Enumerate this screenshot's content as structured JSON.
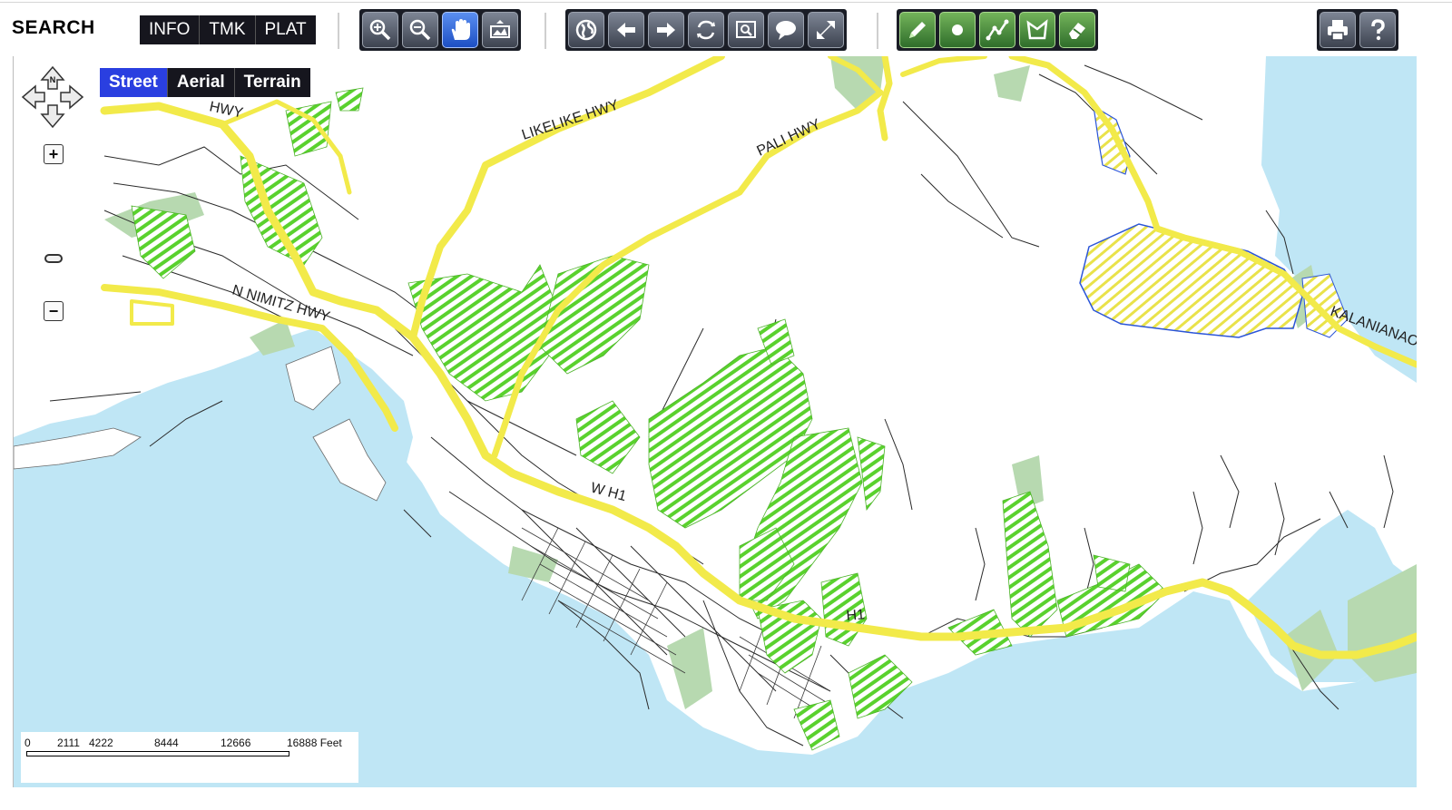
{
  "toolbar": {
    "search_label": "SEARCH",
    "mode_tabs": [
      "INFO",
      "TMK",
      "PLAT"
    ],
    "navigation_tools": [
      {
        "name": "zoom-in-tool",
        "icon": "zoom-in-icon"
      },
      {
        "name": "zoom-out-tool",
        "icon": "zoom-out-icon"
      },
      {
        "name": "pan-tool",
        "icon": "hand-icon",
        "active": true
      },
      {
        "name": "full-extent-tool",
        "icon": "map-extent-icon"
      }
    ],
    "view_tools": [
      {
        "name": "globe-tool",
        "icon": "globe-icon"
      },
      {
        "name": "back-tool",
        "icon": "arrow-left-icon"
      },
      {
        "name": "forward-tool",
        "icon": "arrow-right-icon"
      },
      {
        "name": "refresh-tool",
        "icon": "refresh-icon"
      },
      {
        "name": "zoom-window-tool",
        "icon": "zoom-window-icon"
      },
      {
        "name": "callout-tool",
        "icon": "speech-bubble-icon"
      },
      {
        "name": "resize-tool",
        "icon": "resize-arrows-icon"
      }
    ],
    "draw_tools": [
      {
        "name": "pencil-tool",
        "icon": "pencil-icon"
      },
      {
        "name": "point-tool",
        "icon": "point-icon"
      },
      {
        "name": "line-tool",
        "icon": "polyline-icon"
      },
      {
        "name": "polygon-tool",
        "icon": "polygon-icon"
      },
      {
        "name": "eraser-tool",
        "icon": "eraser-icon"
      }
    ],
    "utility_tools": [
      {
        "name": "print-tool",
        "icon": "printer-icon"
      },
      {
        "name": "help-tool",
        "icon": "question-mark-icon"
      }
    ]
  },
  "map": {
    "basemap_tabs": [
      "Street",
      "Aerial",
      "Terrain"
    ],
    "selected_basemap": "Street",
    "compass_label": "N",
    "zoom_in_glyph": "+",
    "zoom_out_glyph": "−",
    "road_labels": [
      "LIKELIKE HWY",
      "PALI HWY",
      "N NIMITZ HWY",
      "W H1",
      "H1",
      "KALANIANAO",
      "HWY"
    ],
    "colors": {
      "water": "#bfe6f5",
      "land": "#ffffff",
      "park": "#b7d9b0",
      "highway": "#f2ea4a",
      "hatch_green": "#5ad12e",
      "hatch_yellow": "#e9e24a",
      "boundary_blue": "#2b55d8",
      "road": "#2a2a2a"
    }
  },
  "scale_bar": {
    "labels": [
      "0",
      "2111",
      "4222",
      "8444",
      "12666",
      "16888 Feet"
    ]
  }
}
